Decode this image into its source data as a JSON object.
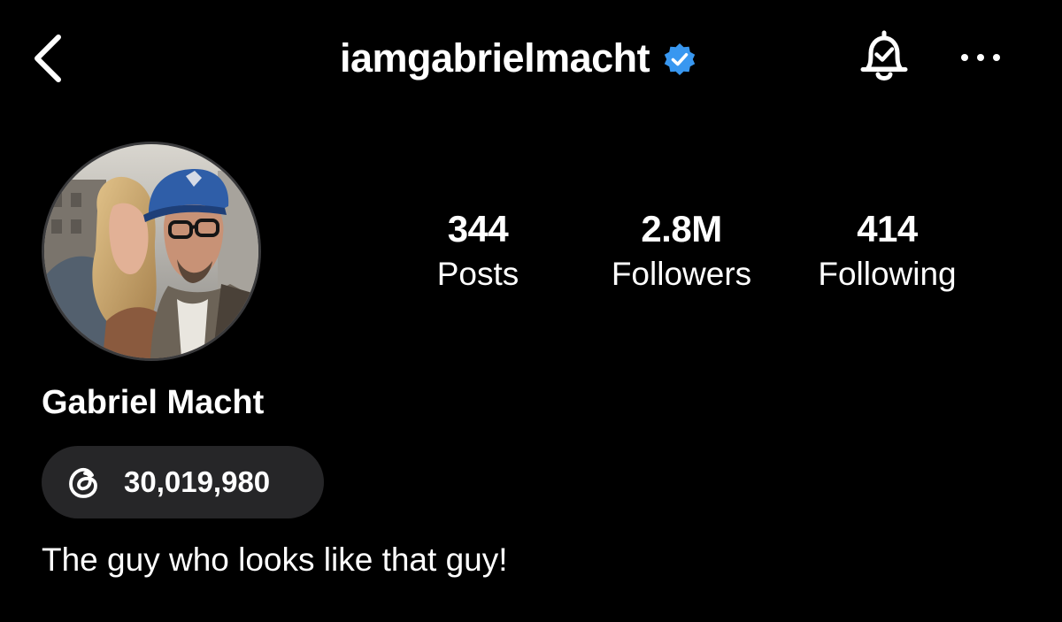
{
  "header": {
    "username": "iamgabrielmacht",
    "verified": true,
    "icons": {
      "back": "chevron-left-icon",
      "verified": "verified-badge-icon",
      "notifications": "bell-check-icon",
      "more": "more-horizontal-icon"
    }
  },
  "profile": {
    "full_name": "Gabriel Macht",
    "bio": "The guy who looks like that guy!",
    "avatar_icon": "profile-photo-avatar"
  },
  "stats": [
    {
      "value": "344",
      "label": "Posts"
    },
    {
      "value": "2.8M",
      "label": "Followers"
    },
    {
      "value": "414",
      "label": "Following"
    }
  ],
  "threads": {
    "icon": "threads-logo-icon",
    "count": "30,019,980"
  },
  "colors": {
    "background": "#000000",
    "text": "#ffffff",
    "verified_blue": "#3897f0",
    "pill_background": "#262628"
  }
}
